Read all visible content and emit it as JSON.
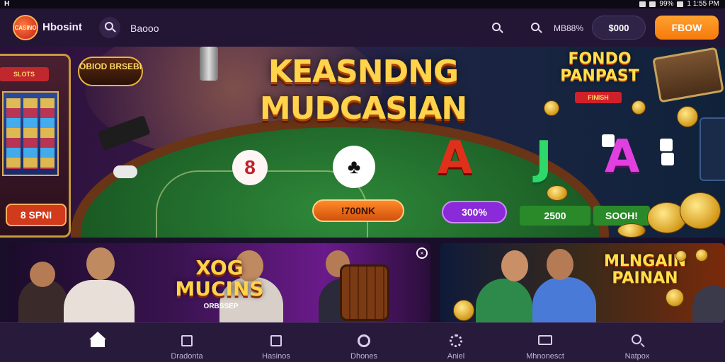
{
  "status_bar": {
    "left": "H",
    "time": "1 1:55 PM",
    "battery": "99%"
  },
  "header": {
    "logo_text": "CASINO",
    "brand": "Hbosint",
    "search_text": "Baooo",
    "user_text": "MB88%",
    "balance": "$000",
    "cta": "FBOW"
  },
  "hero": {
    "title_line1": "KEASNDNG",
    "title_line2": "MUDCASIAN",
    "side_badge": "OBIOD BRSEBI",
    "slot_label": "SLOTS",
    "left_pill": "8 SPNI",
    "orange_pill": "!700NK",
    "purple_pill": "300%",
    "green_pill1": "2500",
    "green_pill2": "SOOH!",
    "promo_title": "FONDO PANPAST",
    "promo_ribbon": "FINISH",
    "card1": "8",
    "card2": "♣",
    "letter_red": "A",
    "letter_green": "J",
    "letter_purple": "A"
  },
  "cards": {
    "left_title": "XOG MUCINS",
    "left_sub": "ORBSSEP",
    "close_icon": "×",
    "right_title": "MLNGAIN PAINAN"
  },
  "bottom_nav": [
    {
      "label": "",
      "icon": "home-icon",
      "active": true
    },
    {
      "label": "Dradonta",
      "icon": "building-icon"
    },
    {
      "label": "Hasinos",
      "icon": "slot-box-icon"
    },
    {
      "label": "Dhones",
      "icon": "ring-icon"
    },
    {
      "label": "Aniel",
      "icon": "gear-icon"
    },
    {
      "label": "Mhnonesct",
      "icon": "monitor-icon"
    },
    {
      "label": "Natpox",
      "icon": "search-icon"
    }
  ],
  "colors": {
    "accent": "#f57a0c",
    "header_bg": "#231534",
    "nav_bg": "#271a3a"
  }
}
